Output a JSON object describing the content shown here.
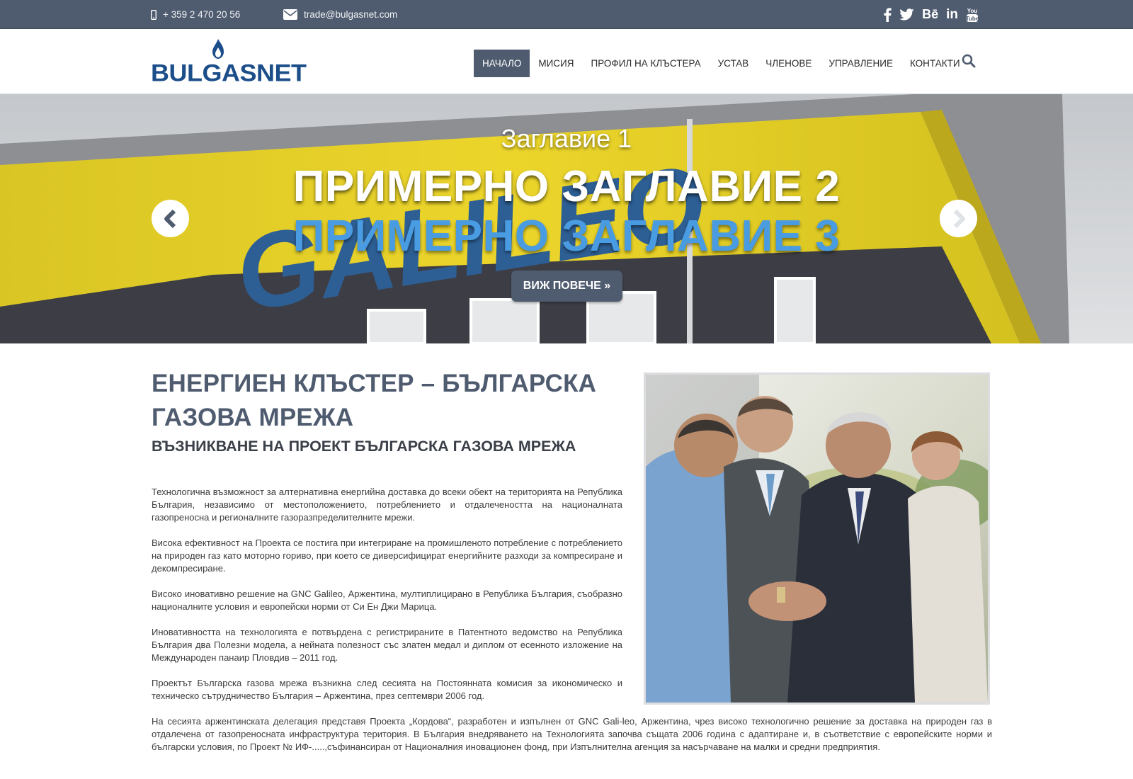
{
  "topbar": {
    "phone": "+ 359 2 470 20 56",
    "email": "trade@bulgasnet.com",
    "social": [
      "facebook-icon",
      "twitter-icon",
      "behance-icon",
      "linkedin-icon",
      "youtube-icon"
    ],
    "background": "#4f5b6f"
  },
  "header": {
    "logo_text": "BULGASNET",
    "nav": [
      "НАЧАЛО",
      "МИСИЯ",
      "ПРОФИЛ НА КЛЪСТЕРА",
      "УСТАВ",
      "ЧЛЕНОВЕ",
      "УПРАВЛЕНИЕ",
      "КОНТАКТИ"
    ],
    "active_index": 0
  },
  "hero": {
    "title1": "Заглавие 1",
    "title2": "ПРИМЕРНО ЗАГЛАВИЕ 2",
    "title3": "ПРИМЕРНО ЗАГЛАВИЕ 3",
    "cta": "ВИЖ ПОВЕЧЕ »",
    "building_sign": "GALILEO",
    "accent": "#4a9ce2"
  },
  "main": {
    "heading": "ЕНЕРГИЕН КЛЪСТЕР – БЪЛГАРСКА ГАЗОВА МРЕЖА",
    "subheading": "ВЪЗНИКВАНЕ НА ПРОЕКТ БЪЛГАРСКА ГАЗОВА МРЕЖА",
    "paragraphs": [
      "Технологична възможност за алтернативна енергийна доставка до всеки обект на територията на Република България, независимо от местоположението, потреблението и отдалечеността на националната газопреносна и регионалните газоразпределителните мрежи.",
      "Висока ефективност на Проекта се постига при интегриране на промишленото потребление с потреблението на природен газ като моторно гориво, при което се диверсифицират енергийните разходи за компресиране и декомпресиране.",
      "Високо иновативно решение на GNC Galileo, Аржентина, мултиплицирано в Република България, съобразно националните условия и европейски норми от Си Ен Джи Марица.",
      "Иновативността на технологията е потвърдена с регистрираните в Патентното ведомство на Република България два Полезни модела, а нейната полезност със златен медал и диплом от есенното изложение на Международен панаир Пловдив – 2011 год.",
      "Проектът Българска газова мрежа възникна след сесията на Постоянната комисия за икономическо и техническо сътрудничество България – Аржентина, през септември 2006 год.",
      "На сесията аржентинската делегация представя Проекта „Кордова“, разработен и изпълнен от GNC Gali-leo, Аржентина, чрез високо технологично решение за доставка на природен газ в отдалечена от газопреносната инфраструктура територия. В България внедряването на Технологията започва същата 2006 година с адаптиране и, в съответствие с европейските норми и български условия, по Проект № ИФ-.....,съфинансиран от Националния иновационен фонд, при Изпълнителна агенция за насърчаване на малки и средни предприятия."
    ]
  }
}
